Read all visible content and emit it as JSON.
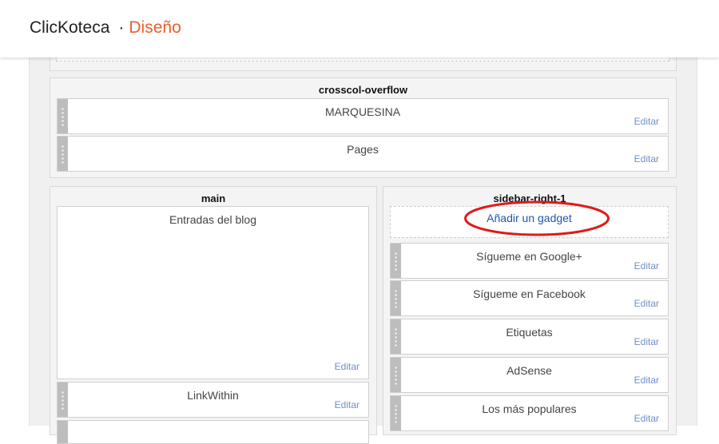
{
  "header": {
    "app_title": "ClicKoteca",
    "separator": "·",
    "section_title": "Diseño"
  },
  "sections": {
    "crosscol_overflow": {
      "title": "crosscol-overflow",
      "widgets": [
        {
          "title": "MARQUESINA",
          "edit": "Editar"
        },
        {
          "title": "Pages",
          "edit": "Editar"
        }
      ]
    },
    "main": {
      "title": "main",
      "widgets": [
        {
          "title": "Entradas del blog",
          "edit": "Editar"
        },
        {
          "title": "LinkWithin",
          "edit": "Editar"
        }
      ]
    },
    "sidebar_right_1": {
      "title": "sidebar-right-1",
      "add_gadget": "Añadir un gadget",
      "widgets": [
        {
          "title": "Sígueme en Google+",
          "edit": "Editar"
        },
        {
          "title": "Sígueme en Facebook",
          "edit": "Editar"
        },
        {
          "title": "Etiquetas",
          "edit": "Editar"
        },
        {
          "title": "AdSense",
          "edit": "Editar"
        },
        {
          "title": "Los más populares",
          "edit": "Editar"
        }
      ]
    }
  },
  "annotation": {
    "color": "#e01b1b",
    "shape": "ellipse"
  },
  "colors": {
    "accent": "#e8602c",
    "link": "#2255b0",
    "edit_link": "#6f8fc7"
  }
}
